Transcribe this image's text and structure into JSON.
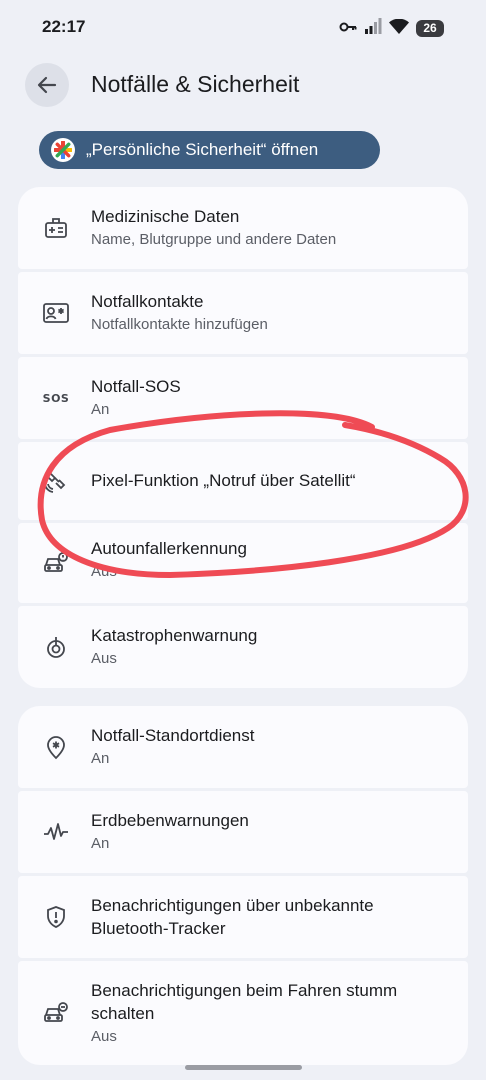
{
  "status_bar": {
    "time": "22:17",
    "battery": "26"
  },
  "header": {
    "title": "Notfälle & Sicherheit"
  },
  "personal_safety_button": {
    "label": "„Persönliche Sicherheit“ öffnen"
  },
  "group1": [
    {
      "title": "Medizinische Daten",
      "subtitle": "Name, Blutgruppe und andere Daten",
      "icon": "medical-card-icon"
    },
    {
      "title": "Notfallkontakte",
      "subtitle": "Notfallkontakte hinzufügen",
      "icon": "contact-card-icon"
    },
    {
      "title": "Notfall-SOS",
      "subtitle": "An",
      "icon": "sos-icon",
      "icon_text": "SOS"
    },
    {
      "title": "Pixel-Funktion „Notruf über Satellit“",
      "subtitle": "",
      "icon": "satellite-icon"
    },
    {
      "title": "Autounfallerkennung",
      "subtitle": "Aus",
      "icon": "car-crash-icon"
    },
    {
      "title": "Katastrophenwarnung",
      "subtitle": "Aus",
      "icon": "disaster-alert-icon"
    }
  ],
  "group2": [
    {
      "title": "Notfall-Standortdienst",
      "subtitle": "An",
      "icon": "location-emergency-icon"
    },
    {
      "title": "Erdbebenwarnungen",
      "subtitle": "An",
      "icon": "earthquake-icon"
    },
    {
      "title": "Benachrichtigungen über unbekannte Bluetooth-Tracker",
      "subtitle": "",
      "icon": "shield-alert-icon"
    },
    {
      "title": "Benachrichtigungen beim Fahren stumm schalten",
      "subtitle": "Aus",
      "icon": "car-mute-icon"
    }
  ],
  "colors": {
    "background": "#eef0f6",
    "card": "#fbfbfe",
    "accent_button": "#3d5d80",
    "annotation": "#ef4b55"
  }
}
